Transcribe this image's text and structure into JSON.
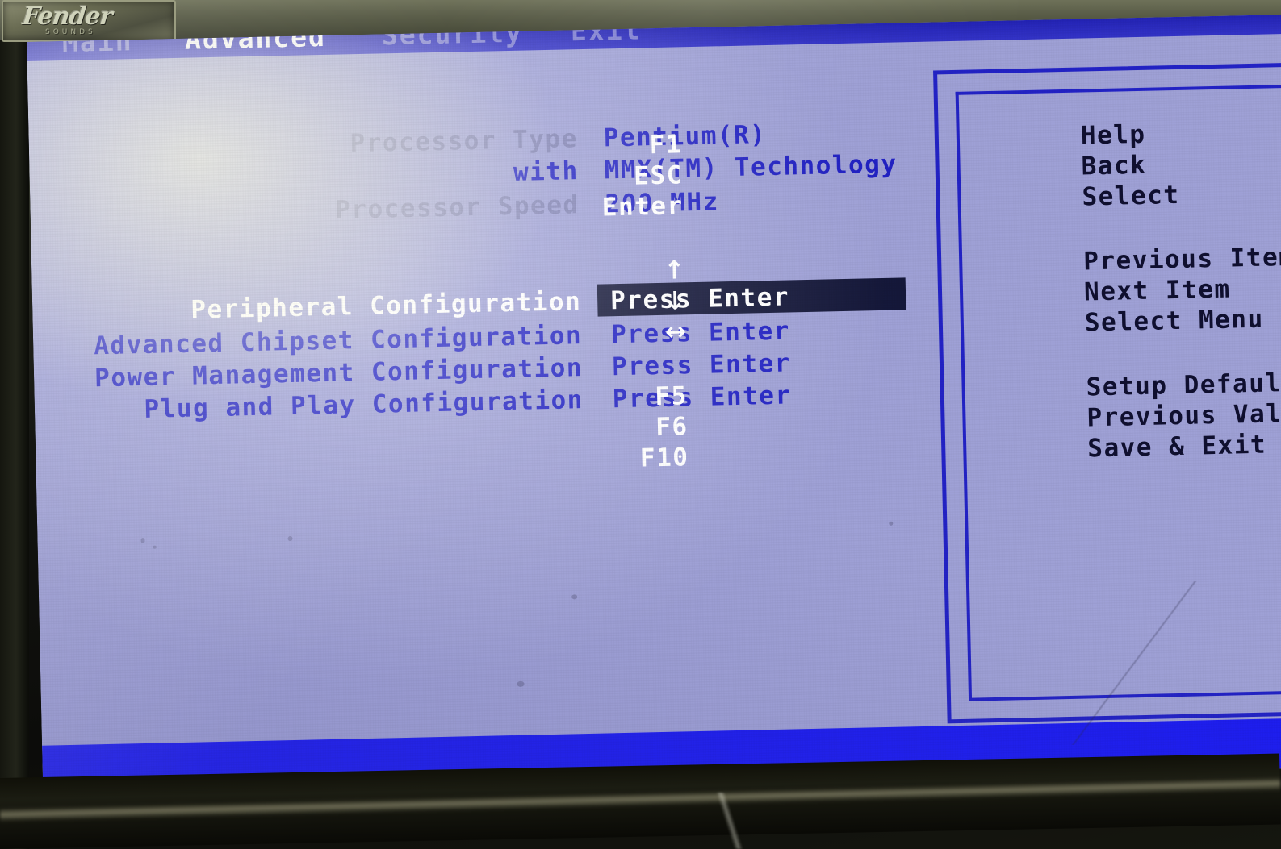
{
  "device": {
    "brand_badge": "Fender",
    "brand_badge_sub": "SOUNDS"
  },
  "bios": {
    "menubar": {
      "tabs": [
        {
          "label": "Main",
          "active": false
        },
        {
          "label": "Advanced",
          "active": true
        },
        {
          "label": "Security",
          "active": false
        },
        {
          "label": "Exit",
          "active": false
        }
      ]
    },
    "info_rows": [
      {
        "label": "Processor Type",
        "value": "Pentium(R)"
      },
      {
        "label": "with",
        "value": "MMX(TM) Technology"
      },
      {
        "label": "Processor Speed",
        "value": "200 MHz"
      }
    ],
    "menu_items": [
      {
        "label": "Peripheral Configuration",
        "action": "Press Enter",
        "selected": true
      },
      {
        "label": "Advanced Chipset Configuration",
        "action": "Press Enter",
        "selected": false
      },
      {
        "label": "Power Management Configuration",
        "action": "Press Enter",
        "selected": false
      },
      {
        "label": "Plug and Play Configuration",
        "action": "Press Enter",
        "selected": false
      }
    ],
    "help_panel": {
      "group_keys": [
        {
          "key": "F1",
          "desc": "Help"
        },
        {
          "key": "ESC",
          "desc": "Back"
        },
        {
          "key": "Enter",
          "desc": "Select"
        }
      ],
      "group_nav": [
        {
          "key": "↑",
          "desc": "Previous Item"
        },
        {
          "key": "↓",
          "desc": "Next Item"
        },
        {
          "key": "↔",
          "desc": "Select Menu"
        }
      ],
      "group_func": [
        {
          "key": "F5",
          "desc": "Setup Defaults"
        },
        {
          "key": "F6",
          "desc": "Previous Values"
        },
        {
          "key": "F10",
          "desc": "Save & Exit"
        }
      ]
    },
    "statusbar": {
      "text": ""
    }
  },
  "colors": {
    "screen_background": "#9fa1d6",
    "text_blue": "#2222c4",
    "text_dim": "#8183b5",
    "text_white": "#ffffff",
    "text_dark": "#101030",
    "highlight_bar": "#15183a",
    "accent_blue": "#2323c6",
    "statusbar_blue": "#1d1df0"
  }
}
